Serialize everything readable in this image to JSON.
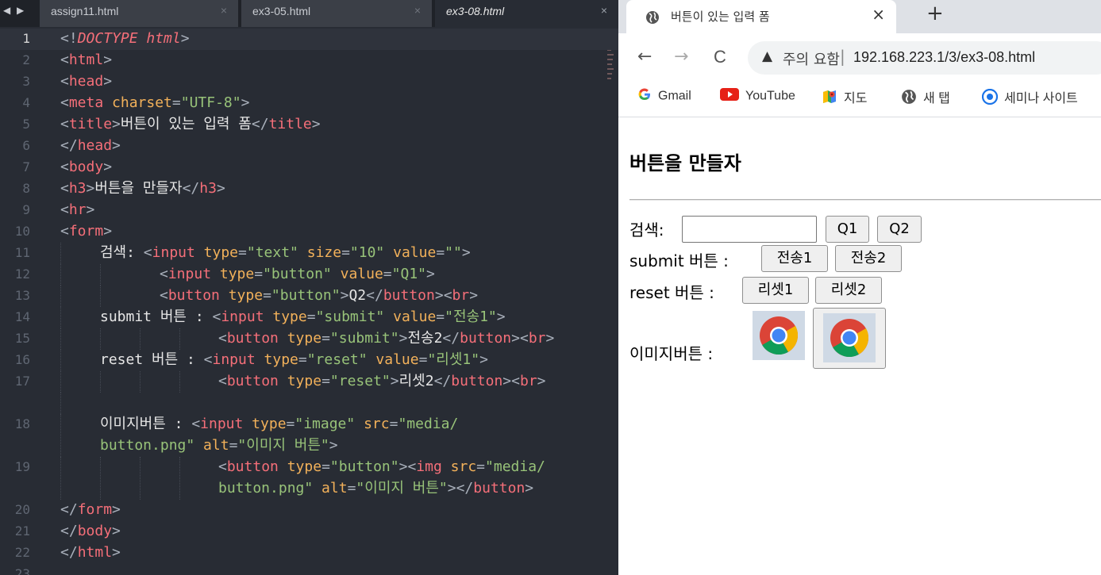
{
  "editor": {
    "tabs": [
      {
        "label": "assign11.html",
        "close": "×"
      },
      {
        "label": "ex3-05.html",
        "close": "×"
      },
      {
        "label": "ex3-08.html",
        "close": "×"
      }
    ],
    "nav_arrows": "◀ ▶",
    "lines": [
      {
        "n": "1"
      },
      {
        "n": "2"
      },
      {
        "n": "3"
      },
      {
        "n": "4"
      },
      {
        "n": "5"
      },
      {
        "n": "6"
      },
      {
        "n": "7"
      },
      {
        "n": "8"
      },
      {
        "n": "9"
      },
      {
        "n": "10"
      },
      {
        "n": "11"
      },
      {
        "n": "12"
      },
      {
        "n": "13"
      },
      {
        "n": "14"
      },
      {
        "n": "15"
      },
      {
        "n": "16"
      },
      {
        "n": "17"
      },
      {
        "n": "18"
      },
      {
        "n": "19"
      },
      {
        "n": "20"
      },
      {
        "n": "21"
      },
      {
        "n": "22"
      },
      {
        "n": "23"
      }
    ],
    "tokens": {
      "doctype_open": "<!",
      "doctype_word": "DOCTYPE",
      "doctype_html": " html",
      "gt": ">",
      "lt": "<",
      "lt_slash": "</",
      "html": "html",
      "head": "head",
      "meta": "meta",
      "charset_attr": " charset",
      "eq": "=",
      "charset_val": "\"UTF-8\"",
      "title": "title",
      "title_text": "버튼이 있는 입력 폼",
      "body": "body",
      "h3": "h3",
      "h3_text": "버튼을 만들자",
      "hr": "hr",
      "form": "form",
      "search_label": "검색: ",
      "input": "input",
      "button": "button",
      "br": "br",
      "img": "img",
      "type": " type",
      "size": " size",
      "value": " value",
      "src": " src",
      "alt": " alt",
      "v_text": "\"text\"",
      "v_10": "\"10\"",
      "v_empty": "\"\"",
      "v_button": "\"button\"",
      "v_q1": "\"Q1\"",
      "q2_text": "Q2",
      "submit_label": "submit 버튼 : ",
      "v_submit": "\"submit\"",
      "v_send1": "\"전송1\"",
      "send2_text": "전송2",
      "reset_label": "reset 버튼 : ",
      "v_reset": "\"reset\"",
      "v_reset1": "\"리셋1\"",
      "reset2_text": "리셋2",
      "image_label": "이미지버튼 : ",
      "v_image": "\"image\"",
      "v_media": "\"media/",
      "v_png": "button.png\"",
      "png_plain": "button.png",
      "v_alt": "\"이미지 버튼\"",
      "quote": "\""
    }
  },
  "browser": {
    "tab_title": "버튼이 있는 입력 폼",
    "tab_close": "×",
    "new_tab": "+",
    "nav": {
      "back": "←",
      "forward": "→",
      "reload": "C"
    },
    "security_icon": "warning-triangle-icon",
    "security_glyph": "▲",
    "security_text": "주의 요함",
    "separator": "|",
    "url": "192.168.223.1/3/ex3-08.html",
    "bookmarks": [
      {
        "icon": "google-icon",
        "label": "Gmail"
      },
      {
        "icon": "youtube-icon",
        "label": "YouTube"
      },
      {
        "icon": "maps-icon",
        "label": "지도"
      },
      {
        "icon": "globe-icon",
        "label": "새 탭"
      },
      {
        "icon": "seminar-icon",
        "label": "세미나 사이트"
      }
    ],
    "page": {
      "heading": "버튼을 만들자",
      "search_label": "검색:",
      "search_value": "",
      "q1": "Q1",
      "q2": "Q2",
      "submit_label": "submit 버튼 :",
      "send1": "전송1",
      "send2": "전송2",
      "reset_label": "reset 버튼 :",
      "reset1": "리셋1",
      "reset2": "리셋2",
      "image_label": "이미지버튼 :",
      "image_alt": "이미지 버튼"
    }
  },
  "colors": {
    "editor_bg": "#282c34",
    "tag": "#f56f79",
    "attr": "#f2b15a",
    "value": "#98c379",
    "bracket": "#a9b0bb",
    "browser_tabstrip": "#dee1e6"
  }
}
